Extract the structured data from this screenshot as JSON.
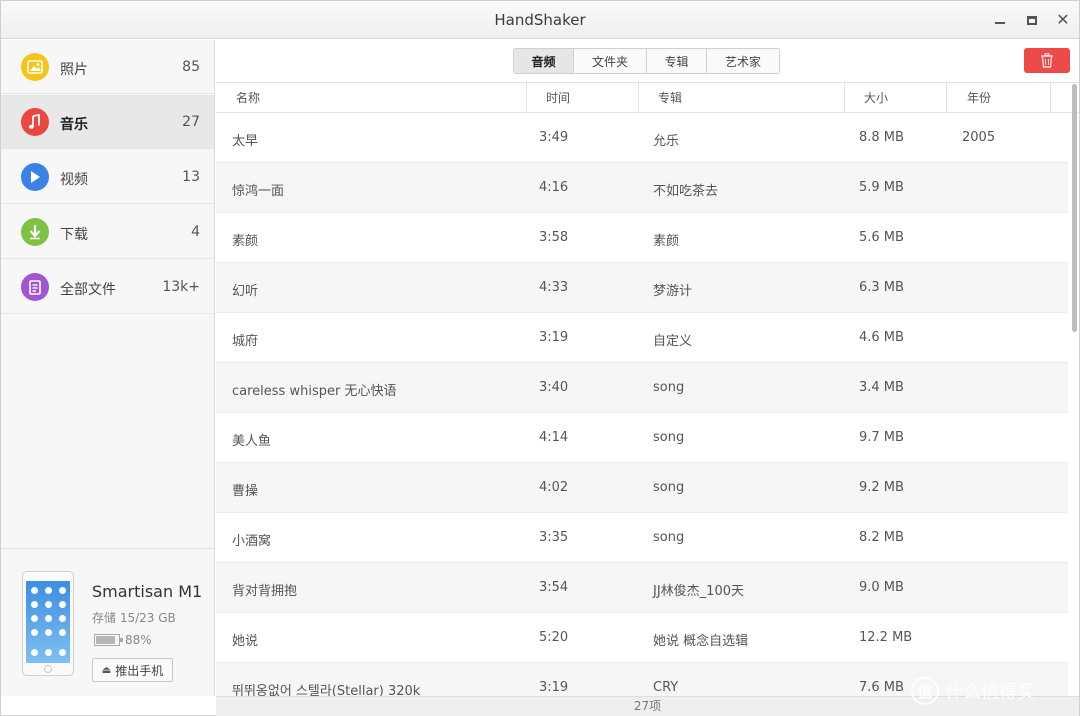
{
  "app": {
    "title": "HandShaker"
  },
  "sidebar": {
    "items": [
      {
        "label": "照片",
        "count": "85",
        "icon": "photo-icon",
        "color": "#f5c518"
      },
      {
        "label": "音乐",
        "count": "27",
        "icon": "music-note-icon",
        "color": "#e9473f"
      },
      {
        "label": "视频",
        "count": "13",
        "icon": "play-icon",
        "color": "#3b82e8"
      },
      {
        "label": "下载",
        "count": "4",
        "icon": "download-arrow-icon",
        "color": "#7cc243"
      },
      {
        "label": "全部文件",
        "count": "13k+",
        "icon": "document-icon",
        "color": "#a055d4"
      }
    ],
    "device": {
      "name": "Smartisan M1",
      "storage": "存储 15/23 GB",
      "battery": "88%",
      "battery_level": 0.88,
      "eject_label": "推出手机"
    }
  },
  "toolbar": {
    "tabs": [
      "音频",
      "文件夹",
      "专辑",
      "艺术家"
    ],
    "active_tab": "音频",
    "delete_color": "#ee4a4a"
  },
  "table": {
    "columns": [
      "名称",
      "时间",
      "专辑",
      "大小",
      "年份"
    ],
    "rows": [
      {
        "name": "太早",
        "time": "3:49",
        "album": "允乐",
        "size": "8.8 MB",
        "year": "2005"
      },
      {
        "name": "惊鸿一面",
        "time": "4:16",
        "album": "不如吃茶去",
        "size": "5.9 MB",
        "year": ""
      },
      {
        "name": "素颜",
        "time": "3:58",
        "album": "素颜",
        "size": "5.6 MB",
        "year": ""
      },
      {
        "name": "幻听",
        "time": "4:33",
        "album": "梦游计",
        "size": "6.3 MB",
        "year": ""
      },
      {
        "name": "城府",
        "time": "3:19",
        "album": "自定义",
        "size": "4.6 MB",
        "year": ""
      },
      {
        "name": "careless whisper 无心快语",
        "time": "3:40",
        "album": "song",
        "size": "3.4 MB",
        "year": ""
      },
      {
        "name": "美人鱼",
        "time": "4:14",
        "album": "song",
        "size": "9.7 MB",
        "year": ""
      },
      {
        "name": "曹操",
        "time": "4:02",
        "album": "song",
        "size": "9.2 MB",
        "year": ""
      },
      {
        "name": "小酒窝",
        "time": "3:35",
        "album": "song",
        "size": "8.2 MB",
        "year": ""
      },
      {
        "name": "背对背拥抱",
        "time": "3:54",
        "album": "JJ林俊杰_100天",
        "size": "9.0 MB",
        "year": ""
      },
      {
        "name": "她说",
        "time": "5:20",
        "album": "她说 概念自选辑",
        "size": "12.2 MB",
        "year": ""
      },
      {
        "name": "뛰뛰옹없어  스텔라(Stellar) 320k",
        "time": "3:19",
        "album": "CRY",
        "size": "7.6 MB",
        "year": ""
      }
    ]
  },
  "status": {
    "count": "27项"
  },
  "watermark": {
    "text": "什么值得买",
    "mark": "值"
  }
}
